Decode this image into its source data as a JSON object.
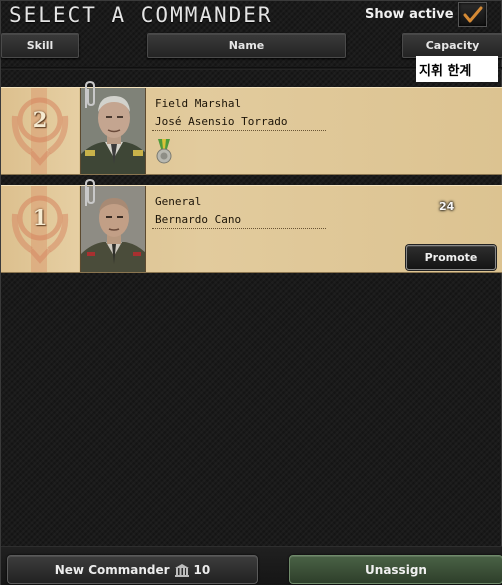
{
  "title": "Select a Commander",
  "show_active": {
    "label": "Show active",
    "checked": true
  },
  "columns": {
    "skill": "Skill",
    "name": "Name",
    "capacity": "Capacity"
  },
  "tooltip": "지휘 한계",
  "commanders": [
    {
      "skill": "2",
      "rank": "Field Marshal",
      "name": "José Asensio Torrado",
      "capacity": "",
      "has_medal": true
    },
    {
      "skill": "1",
      "rank": "General",
      "name": "Bernardo Cano",
      "capacity": "24",
      "promote_label": "Promote"
    }
  ],
  "bottom": {
    "new_commander_label": "New Commander",
    "new_commander_cost": "10",
    "unassign_label": "Unassign"
  },
  "colors": {
    "card_bg": "#e2cb9d",
    "unassign_bg": "#3d5439",
    "panel_bg": "#1b1b1b"
  },
  "icons": [
    "check-icon",
    "paperclip-icon",
    "laurel-emblem-icon",
    "medal-icon",
    "command-power-icon"
  ]
}
